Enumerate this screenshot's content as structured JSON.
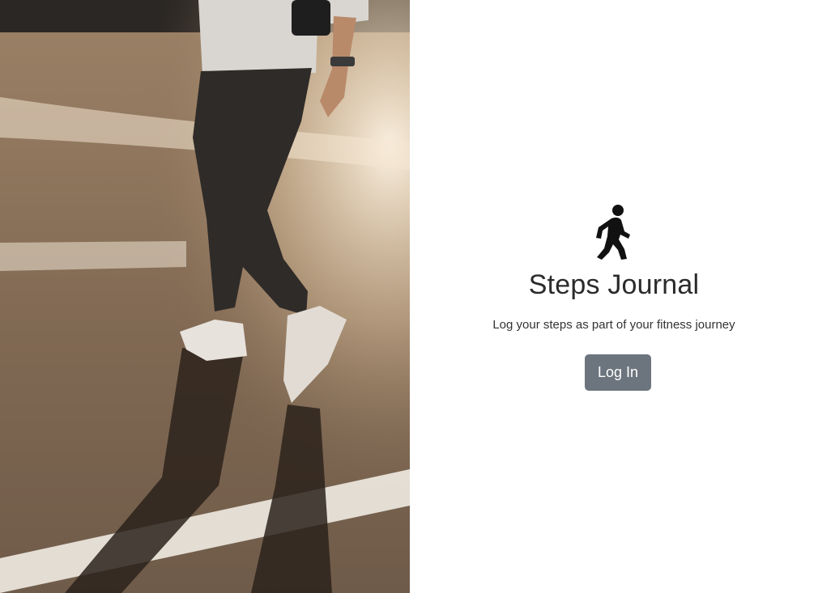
{
  "hero_image": {
    "subject": "person-walking-on-street"
  },
  "login": {
    "logo_icon": "person-walking-icon",
    "title": "Steps Journal",
    "tagline": "Log your steps as part of your fitness journey",
    "login_label": "Log In"
  },
  "colors": {
    "button_bg": "#6c757d",
    "button_text": "#ffffff",
    "title_text": "#2b2b2b",
    "body_text": "#333333",
    "background": "#ffffff"
  }
}
